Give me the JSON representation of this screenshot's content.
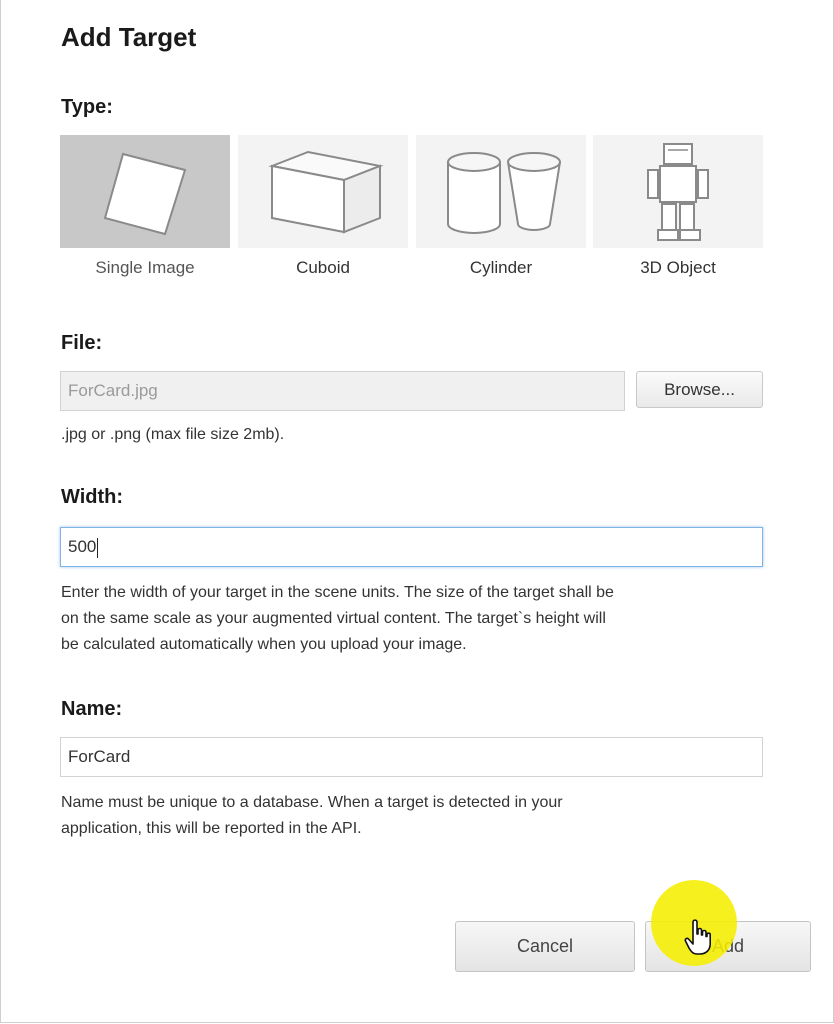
{
  "dialog": {
    "title": "Add Target"
  },
  "type_section": {
    "label": "Type:",
    "options": [
      {
        "label": "Single Image",
        "icon": "single-image-icon",
        "selected": true
      },
      {
        "label": "Cuboid",
        "icon": "cuboid-icon",
        "selected": false
      },
      {
        "label": "Cylinder",
        "icon": "cylinder-icon",
        "selected": false
      },
      {
        "label": "3D Object",
        "icon": "3d-object-icon",
        "selected": false
      }
    ]
  },
  "file_section": {
    "label": "File:",
    "value": "ForCard.jpg",
    "browse_label": "Browse...",
    "help": ".jpg or .png (max file size 2mb)."
  },
  "width_section": {
    "label": "Width:",
    "value": "500",
    "help": [
      "Enter the width of your target in the scene units. The size of the target shall be",
      "on the same scale as your augmented virtual content. The target`s height will",
      "be calculated automatically when you upload your image."
    ]
  },
  "name_section": {
    "label": "Name:",
    "value": "ForCard",
    "help": [
      "Name must be unique to a database. When a target is detected in your",
      "application, this will be reported in the API."
    ]
  },
  "actions": {
    "cancel_label": "Cancel",
    "add_label": "Add"
  },
  "colors": {
    "selected_tile": "#c8c8c8",
    "tile": "#f3f3f3",
    "cursor_highlight": "#f6ee00",
    "focus_border": "#7fb5e6"
  }
}
